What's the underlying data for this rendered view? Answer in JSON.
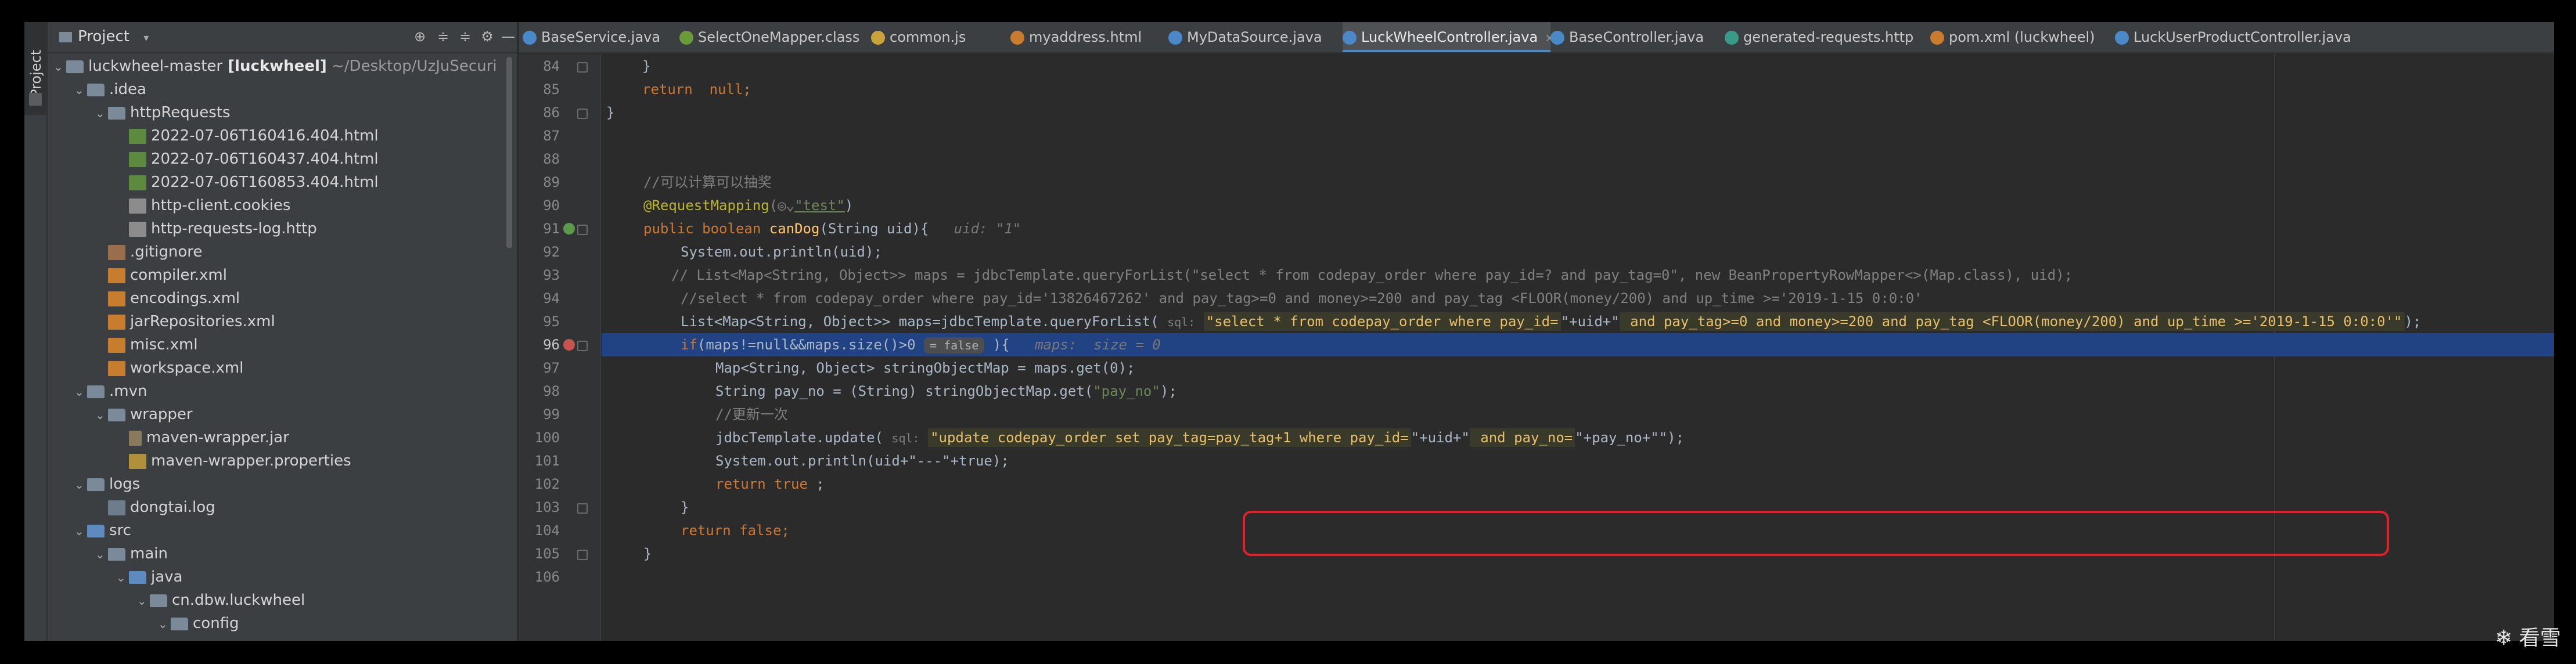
{
  "toolstrip": {
    "project_tab": "Project"
  },
  "project_panel": {
    "title": "Project",
    "tree": [
      {
        "depth": 0,
        "arrow": "⌄",
        "icon": "folder",
        "label": "luckwheel-master",
        "bold": "[luckwheel]",
        "suffix": "~/Desktop/UzJuSecuri"
      },
      {
        "depth": 1,
        "arrow": "⌄",
        "icon": "folder",
        "label": ".idea"
      },
      {
        "depth": 2,
        "arrow": "⌄",
        "icon": "folder",
        "label": "httpRequests"
      },
      {
        "depth": 3,
        "arrow": "",
        "icon": "html",
        "label": "2022-07-06T160416.404.html"
      },
      {
        "depth": 3,
        "arrow": "",
        "icon": "html",
        "label": "2022-07-06T160437.404.html"
      },
      {
        "depth": 3,
        "arrow": "",
        "icon": "html",
        "label": "2022-07-06T160853.404.html"
      },
      {
        "depth": 3,
        "arrow": "",
        "icon": "file",
        "label": "http-client.cookies"
      },
      {
        "depth": 3,
        "arrow": "",
        "icon": "file",
        "label": "http-requests-log.http"
      },
      {
        "depth": 2,
        "arrow": "",
        "icon": "git",
        "label": ".gitignore"
      },
      {
        "depth": 2,
        "arrow": "",
        "icon": "xml",
        "label": "compiler.xml"
      },
      {
        "depth": 2,
        "arrow": "",
        "icon": "xml",
        "label": "encodings.xml"
      },
      {
        "depth": 2,
        "arrow": "",
        "icon": "xml",
        "label": "jarRepositories.xml"
      },
      {
        "depth": 2,
        "arrow": "",
        "icon": "xml",
        "label": "misc.xml"
      },
      {
        "depth": 2,
        "arrow": "",
        "icon": "xml",
        "label": "workspace.xml"
      },
      {
        "depth": 1,
        "arrow": "⌄",
        "icon": "folder",
        "label": ".mvn"
      },
      {
        "depth": 2,
        "arrow": "⌄",
        "icon": "folder",
        "label": "wrapper"
      },
      {
        "depth": 3,
        "arrow": "",
        "icon": "jar",
        "label": "maven-wrapper.jar"
      },
      {
        "depth": 3,
        "arrow": "",
        "icon": "props",
        "label": "maven-wrapper.properties"
      },
      {
        "depth": 1,
        "arrow": "⌄",
        "icon": "folder",
        "label": "logs"
      },
      {
        "depth": 2,
        "arrow": "",
        "icon": "log",
        "label": "dongtai.log"
      },
      {
        "depth": 1,
        "arrow": "⌄",
        "icon": "folder blue",
        "label": "src"
      },
      {
        "depth": 2,
        "arrow": "⌄",
        "icon": "folder",
        "label": "main"
      },
      {
        "depth": 3,
        "arrow": "⌄",
        "icon": "folder blue",
        "label": "java"
      },
      {
        "depth": 4,
        "arrow": "⌄",
        "icon": "folder",
        "label": "cn.dbw.luckwheel"
      },
      {
        "depth": 5,
        "arrow": "⌄",
        "icon": "folder",
        "label": "config"
      }
    ]
  },
  "tabs": [
    {
      "label": "BaseService.java",
      "color": "#4a88c7",
      "active": false
    },
    {
      "label": "SelectOneMapper.class",
      "color": "#6a9a3a",
      "active": false
    },
    {
      "label": "common.js",
      "color": "#c7a33a",
      "active": false
    },
    {
      "label": "myaddress.html",
      "color": "#c77c2e",
      "active": false
    },
    {
      "label": "MyDataSource.java",
      "color": "#4a88c7",
      "active": false
    },
    {
      "label": "LuckWheelController.java",
      "color": "#4a88c7",
      "active": true
    },
    {
      "label": "BaseController.java",
      "color": "#4a88c7",
      "active": false
    },
    {
      "label": "generated-requests.http",
      "color": "#3a9a8a",
      "active": false
    },
    {
      "label": "pom.xml (luckwheel)",
      "color": "#c77c2e",
      "active": false
    },
    {
      "label": "LuckUserProductController.java",
      "color": "#4a88c7",
      "active": false
    }
  ],
  "editor": {
    "line_numbers": [
      "84",
      "85",
      "86",
      "87",
      "88",
      "89",
      "90",
      "91",
      "92",
      "93",
      "94",
      "95",
      "96",
      "97",
      "98",
      "99",
      "100",
      "101",
      "102",
      "103",
      "104",
      "105",
      "106"
    ],
    "current_line": "96",
    "hint_uid": "uid: \"1\"",
    "hint_maps": "maps:  size = 0",
    "hint_false": "= false",
    "lang_sql": "sql:",
    "lines": {
      "l84": "}",
      "l85_kw": "return",
      "l85_rest": "  null;",
      "l86": "}",
      "l89": "//可以计算可以抽奖",
      "l90_an": "@RequestMapping",
      "l90_glyph": "(◎⌄",
      "l90_str": "\"test\"",
      "l90_end": ")",
      "l91_kw": "public boolean",
      "l91_fn": "canDog",
      "l91_rest": "(String uid){",
      "l92": "System.out.println(uid);",
      "l93": "// List<Map<String, Object>> maps = jdbcTemplate.queryForList(\"select * from codepay_order where pay_id=? and pay_tag=0\", new BeanPropertyRowMapper<>(Map.class), uid);",
      "l94": "//select * from codepay_order where pay_id='13826467262' and pay_tag>=0 and money>=200 and pay_tag <FLOOR(money/200) and up_time >='2019-1-15 0:0:0'",
      "l95_pre": "List<Map<String, Object>> maps=jdbcTemplate.queryForList(",
      "l95_sql": "\"select * from codepay_order where pay_id=",
      "l95_mid": "\"+uid+\"",
      "l95_sql2": " and pay_tag>=0 and money>=200 and pay_tag <FLOOR(money/200) and up_time >='2019-1-15 0:0:0'\"",
      "l95_end": ");",
      "l96_kw": "if",
      "l96_rest": "(maps!=null&&maps.size()>0",
      "l96_end": "){",
      "l97": "Map<String, Object> stringObjectMap = maps.get(0);",
      "l98_pre": "String pay_no = (String) stringObjectMap.get(",
      "l98_str": "\"pay_no\"",
      "l98_end": ");",
      "l99": "//更新一次",
      "l100_pre": "jdbcTemplate.update(",
      "l100_sql": "\"update codepay_order set pay_tag=pay_tag+1 where pay_id=",
      "l100_mid": "\"+uid+\"",
      "l100_sql2": " and pay_no=",
      "l100_mid2": "\"+pay_no+\"",
      "l100_end": "\");",
      "l101": "System.out.println(uid+\"---\"+true);",
      "l102_kw": "return true",
      "l102_end": " ;",
      "l103": "}",
      "l104_kw": "return false",
      "l104_end": ";",
      "l105": "}"
    }
  },
  "watermark": "❄ 看雪"
}
